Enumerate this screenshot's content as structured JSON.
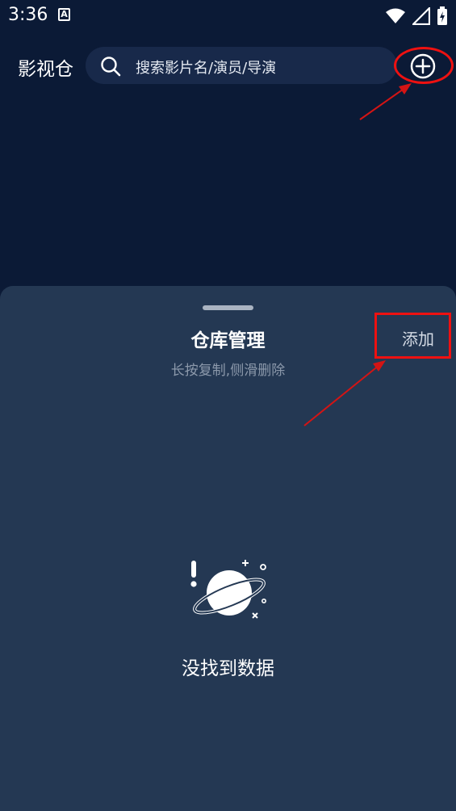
{
  "status_bar": {
    "time": "3:36",
    "notification_icon_letter": "A",
    "icons": [
      "wifi-icon",
      "signal-icon",
      "battery-icon"
    ]
  },
  "header": {
    "title": "影视仓",
    "search_placeholder": "搜索影片名/演员/导演",
    "add_icon": "plus-circle-icon"
  },
  "sheet": {
    "title": "仓库管理",
    "subtitle": "长按复制,侧滑删除",
    "add_label": "添加",
    "empty_icon": "planet-icon",
    "empty_text": "没找到数据"
  },
  "colors": {
    "background": "#0b1a36",
    "sheet_background": "#243853",
    "annotation": "#e11111"
  }
}
